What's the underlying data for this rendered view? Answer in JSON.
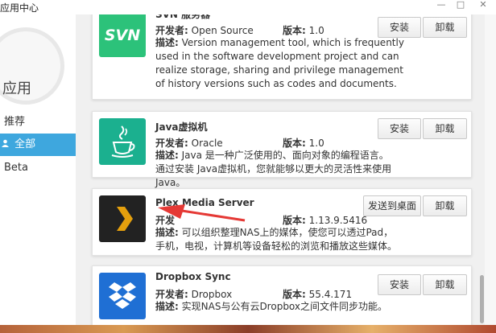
{
  "window": {
    "title": "应用中心",
    "min": "—",
    "max": "□",
    "close": "✕"
  },
  "sidebar": {
    "avatar_label": "应用",
    "items": [
      {
        "label": "推荐",
        "active": false
      },
      {
        "label": "全部",
        "active": true,
        "icon": "user-icon"
      },
      {
        "label": "Beta",
        "active": false
      }
    ]
  },
  "apps": [
    {
      "name": "SVN 服务器",
      "logo_text": "SVN",
      "logo_color": "#2cc27a",
      "developer_label": "开发者:",
      "developer": "Open Source",
      "version_label": "版本:",
      "version": "1.0",
      "desc_label": "描述:",
      "description": "Version management tool, which is frequently used in the software development project and can realize storage, sharing and privilege management of history versions such as codes and documents.",
      "buttons": [
        "安装",
        "卸载"
      ]
    },
    {
      "name": "Java虚拟机",
      "logo_color": "#1bb08f",
      "developer_label": "开发者:",
      "developer": "Oracle",
      "version_label": "版本:",
      "version": "1.0",
      "desc_label": "描述:",
      "description": "Java 是一种广泛使用的、面向对象的编程语言。通过安装 Java虚拟机，您就能够以更大的灵活性来使用 Java。",
      "buttons": [
        "安装",
        "卸载"
      ]
    },
    {
      "name": "Plex Media Server",
      "logo_color": "#222222",
      "accent": "#e5a00d",
      "developer_label": "开发",
      "developer": "",
      "version_label": "版本:",
      "version": "1.13.9.5416",
      "desc_label": "描述:",
      "description": "可以组织整理NAS上的媒体，使您可以透过Pad，手机，电视，计算机等设备轻松的浏览和播放这些媒体。",
      "buttons": [
        "发送到桌面",
        "卸载"
      ]
    },
    {
      "name": "Dropbox Sync",
      "logo_color": "#1f6fd4",
      "developer_label": "开发者:",
      "developer": "Dropbox",
      "version_label": "版本:",
      "version": "55.4.171",
      "desc_label": "描述:",
      "description": "实现NAS与公有云Dropbox之间文件同步功能。",
      "buttons": [
        "安装",
        "卸载"
      ]
    }
  ],
  "colors": {
    "active_nav": "#3ea7de",
    "annotation_arrow": "#e53935"
  }
}
